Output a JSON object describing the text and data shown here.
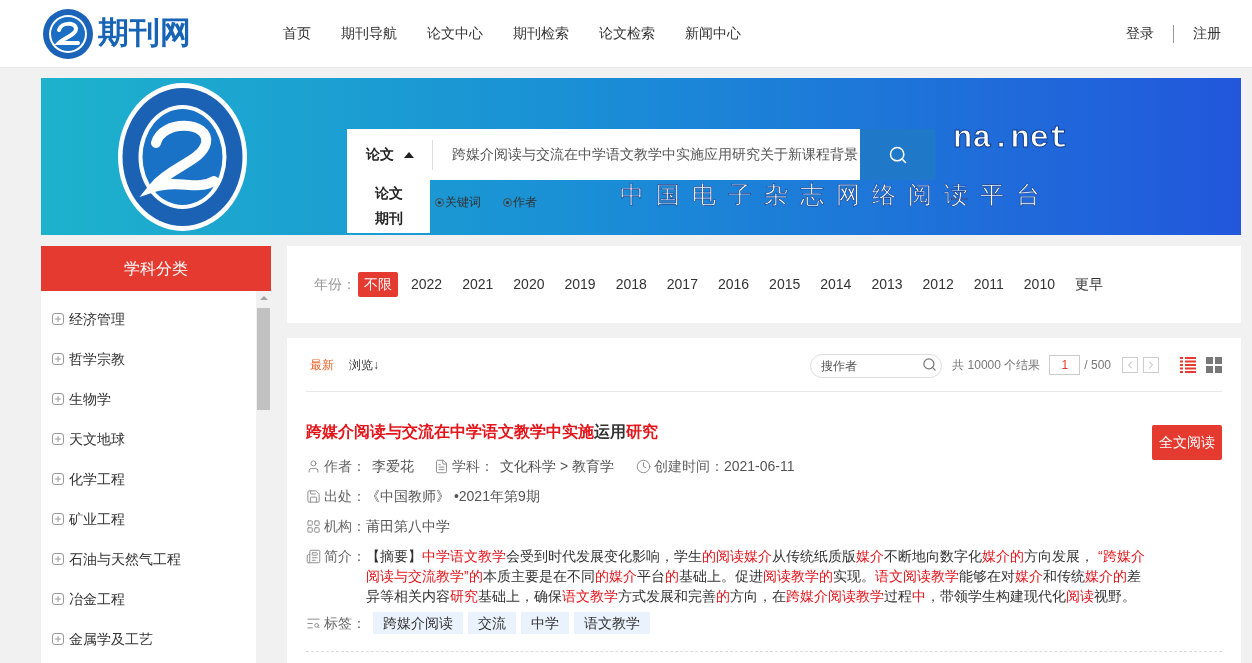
{
  "header": {
    "brand": "期刊网",
    "nav": [
      "首页",
      "期刊导航",
      "论文中心",
      "期刊检索",
      "论文检索",
      "新闻中心"
    ],
    "auth": [
      "登录",
      "注册"
    ]
  },
  "banner": {
    "domain": "na.net",
    "slogan": "中国电子杂志网络阅读平台",
    "search": {
      "type": "论文",
      "expanded": true,
      "value": "跨媒介阅读与交流在中学语文教学中实施应用研究关于新课程背景",
      "type_options": [
        "论文",
        "期刊"
      ],
      "scopes": [
        {
          "label": "关键词",
          "selected": false
        },
        {
          "label": "作者",
          "selected": false
        }
      ]
    }
  },
  "sidebar": {
    "title": "学科分类",
    "items": [
      {
        "label": "经济管理",
        "expanded": false
      },
      {
        "label": "哲学宗教",
        "expanded": false
      },
      {
        "label": "生物学",
        "expanded": false
      },
      {
        "label": "天文地球",
        "expanded": false
      },
      {
        "label": "化学工程",
        "expanded": false
      },
      {
        "label": "矿业工程",
        "expanded": false
      },
      {
        "label": "石油与天然气工程",
        "expanded": false
      },
      {
        "label": "冶金工程",
        "expanded": false
      },
      {
        "label": "金属学及工艺",
        "expanded": false
      }
    ]
  },
  "year_filter": {
    "label": "年份：",
    "options": [
      {
        "label": "不限",
        "selected": true
      },
      {
        "label": "2022",
        "selected": false
      },
      {
        "label": "2021",
        "selected": false
      },
      {
        "label": "2020",
        "selected": false
      },
      {
        "label": "2019",
        "selected": false
      },
      {
        "label": "2018",
        "selected": false
      },
      {
        "label": "2017",
        "selected": false
      },
      {
        "label": "2016",
        "selected": false
      },
      {
        "label": "2015",
        "selected": false
      },
      {
        "label": "2014",
        "selected": false
      },
      {
        "label": "2013",
        "selected": false
      },
      {
        "label": "2012",
        "selected": false
      },
      {
        "label": "2011",
        "selected": false
      },
      {
        "label": "2010",
        "selected": false
      },
      {
        "label": "更早",
        "selected": false
      }
    ]
  },
  "results": {
    "sort_options": [
      {
        "label": "最新",
        "selected": true
      },
      {
        "label": "浏览↓",
        "selected": false
      }
    ],
    "author_search": {
      "placeholder": "搜作者"
    },
    "total": "共 10000 个结果",
    "page": {
      "current": "1",
      "total": "/ 500"
    },
    "view_modes": [
      {
        "kind": "list",
        "selected": true
      },
      {
        "kind": "grid",
        "selected": false
      }
    ],
    "articles": [
      {
        "title": [
          {
            "text": "跨媒介阅读与交流在中学语文教学中实施",
            "highlight": true
          },
          {
            "text": "运用",
            "highlight": false
          },
          {
            "text": "研究",
            "highlight": true
          }
        ],
        "read_button": "全文阅读",
        "author": {
          "label": "作者：",
          "value": "李爱花"
        },
        "subject": {
          "label": "学科：",
          "value": "文化科学 > 教育学"
        },
        "created": {
          "label": "创建时间：",
          "value": "2021-06-11"
        },
        "source": {
          "label": "出处：",
          "value": "《中国教师》 •2021年第9期"
        },
        "institution": {
          "label": "机构：",
          "value": "莆田第八中学"
        },
        "abstract": {
          "label": "简介：",
          "segments": [
            {
              "text": "【摘要】",
              "highlight": false
            },
            {
              "text": "中学语文教学",
              "highlight": true
            },
            {
              "text": "会受到时代发展变化影响，学生",
              "highlight": false
            },
            {
              "text": "的阅读媒介",
              "highlight": true
            },
            {
              "text": "从传统纸质版",
              "highlight": false
            },
            {
              "text": "媒介",
              "highlight": true
            },
            {
              "text": "不断地向数字化",
              "highlight": false
            },
            {
              "text": "媒介的",
              "highlight": true
            },
            {
              "text": "方向发展， ",
              "highlight": false
            },
            {
              "text": "“跨媒介阅读与交流教学”的",
              "highlight": true
            },
            {
              "text": "本质主要是在不同",
              "highlight": false
            },
            {
              "text": "的媒介",
              "highlight": true
            },
            {
              "text": "平台",
              "highlight": false
            },
            {
              "text": "的",
              "highlight": true
            },
            {
              "text": "基础上。促进",
              "highlight": false
            },
            {
              "text": "阅读教学的",
              "highlight": true
            },
            {
              "text": "实现。",
              "highlight": false
            },
            {
              "text": "语文阅读教学",
              "highlight": true
            },
            {
              "text": "能够在对",
              "highlight": false
            },
            {
              "text": "媒介",
              "highlight": true
            },
            {
              "text": "和传统",
              "highlight": false
            },
            {
              "text": "媒介的",
              "highlight": true
            },
            {
              "text": "差异等相关内容",
              "highlight": false
            },
            {
              "text": "研究",
              "highlight": true
            },
            {
              "text": "基础上，确保",
              "highlight": false
            },
            {
              "text": "语文教学",
              "highlight": true
            },
            {
              "text": "方式发展和完善",
              "highlight": false
            },
            {
              "text": "的",
              "highlight": true
            },
            {
              "text": "方向，在",
              "highlight": false
            },
            {
              "text": "跨媒介阅读教学",
              "highlight": true
            },
            {
              "text": "过程",
              "highlight": false
            },
            {
              "text": "中",
              "highlight": true
            },
            {
              "text": "，带领学生构建现代化",
              "highlight": false
            },
            {
              "text": "阅读",
              "highlight": true
            },
            {
              "text": "视野。",
              "highlight": false
            }
          ]
        },
        "tags": {
          "label": "标签：",
          "items": [
            "跨媒介阅读",
            "交流",
            "中学",
            "语文教学"
          ]
        }
      }
    ]
  }
}
